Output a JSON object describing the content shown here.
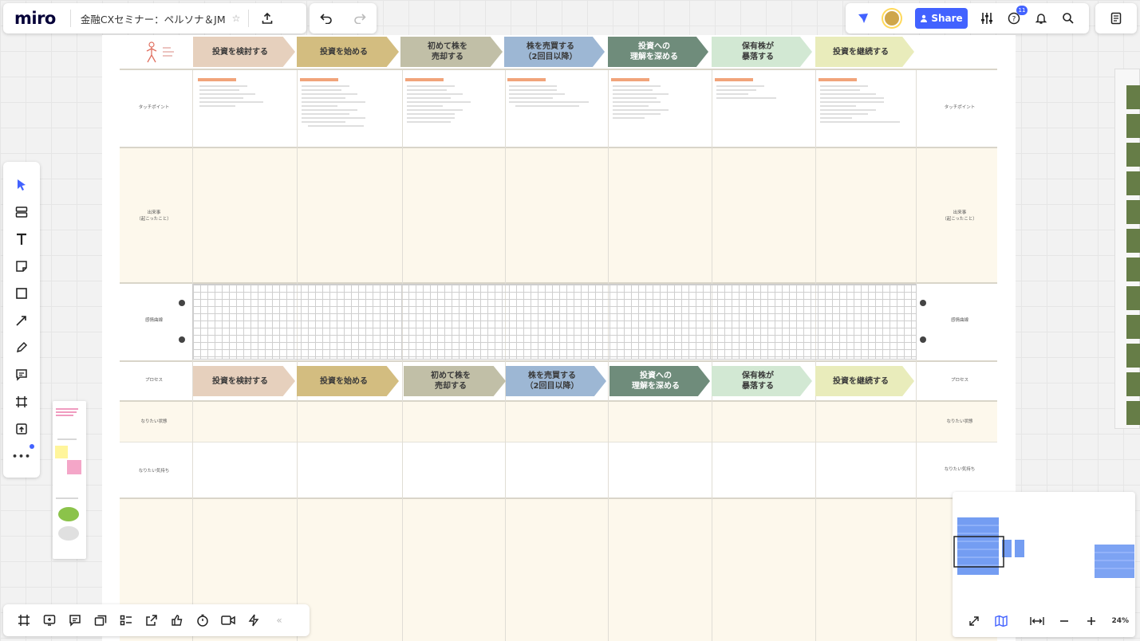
{
  "app": {
    "logo": "miro",
    "board_title": "金融CXセミナー：ペルソナ＆JM",
    "star": "☆",
    "share_label": "Share",
    "help_badge": "11"
  },
  "toolbar": {
    "tools": [
      "select-icon",
      "templates-icon",
      "text-icon",
      "sticky-note-icon",
      "shape-icon",
      "pen-arrow-icon",
      "pencil-icon",
      "comment-icon",
      "frame-icon",
      "upload-icon"
    ],
    "more": "•••"
  },
  "board": {
    "stages": [
      {
        "label": "投資を検討する",
        "color": "#e6d0bd"
      },
      {
        "label": "投資を始める",
        "color": "#d3bd80"
      },
      {
        "label": "初めて株を\n売却する",
        "color": "#c1bfa7"
      },
      {
        "label": "株を売買する\n（2回目以降）",
        "color": "#9db7d4"
      },
      {
        "label": "投資への\n理解を深める",
        "color": "#6f8c7b"
      },
      {
        "label": "保有株が\n暴落する",
        "color": "#d2e8d3"
      },
      {
        "label": "投資を継続する",
        "color": "#e9ecbb"
      }
    ],
    "row_labels": {
      "touchpoint": "タッチポイント",
      "event": "出来事\n（起こったこと）",
      "emotion": "感情曲線",
      "process": "プロセス",
      "ideal_state": "なりたい状態",
      "ideal_feeling": "なりたい気持ち"
    }
  },
  "minimap": {
    "zoom": "24%"
  },
  "bottombar": {
    "tools": [
      "frame-icon",
      "screen-share-icon",
      "comment-icon",
      "cards-icon",
      "list-icon",
      "export-icon",
      "like-icon",
      "timer-icon",
      "video-icon",
      "lightning-icon"
    ],
    "collapse": "«"
  },
  "colors": {
    "accent": "#4262ff",
    "beige": "#fdf8ec",
    "strip_green": "#667d47"
  }
}
